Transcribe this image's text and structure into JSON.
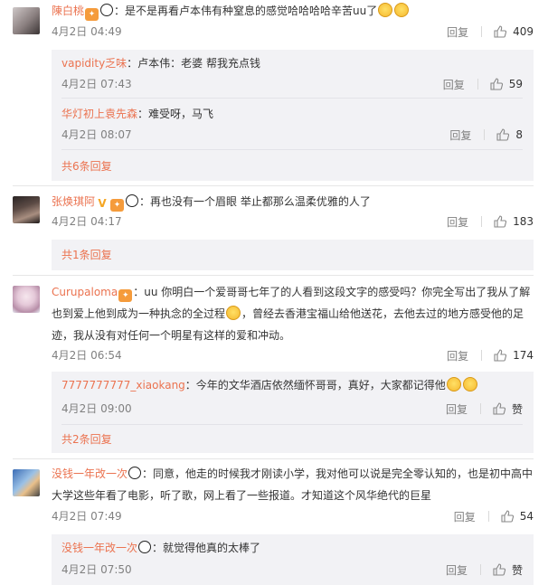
{
  "comments": [
    {
      "user": "陳白桃",
      "text": "：是不是再看卢本伟有种窒息的感觉哈哈哈哈辛苦uu了",
      "date": "4月2日 04:49",
      "reply": "回复",
      "likes": "409",
      "replies": [
        {
          "user": "vapidity乏味",
          "text": "：卢本伟：老婆 帮我充点钱",
          "date": "4月2日 07:43",
          "reply": "回复",
          "likes": "59"
        },
        {
          "user": "华灯初上袁先森",
          "text": "：难受呀，马飞",
          "date": "4月2日 08:07",
          "reply": "回复",
          "likes": "8"
        }
      ],
      "more": "共6条回复"
    },
    {
      "user": "张焕琪阿",
      "text": "：再也没有一个眉眼 举止都那么温柔优雅的人了",
      "date": "4月2日 04:17",
      "reply": "回复",
      "likes": "183",
      "more": "共1条回复"
    },
    {
      "user": "Curupaloma",
      "text": "：uu 你明白一个爱哥哥七年了的人看到这段文字的感受吗？你完全写出了我从了解也到爱上他到成为一种执念的全过程",
      "text2": "，曾经去香港宝福山给他送花，去他去过的地方感受他的足迹，我从没有对任何一个明星有这样的爱和冲动。",
      "date": "4月2日 06:54",
      "reply": "回复",
      "likes": "174",
      "replies": [
        {
          "user": "7777777777_xiaokang",
          "text": "：今年的文华酒店依然缅怀哥哥，真好，大家都记得他",
          "date": "4月2日 09:00",
          "reply": "回复",
          "likes": "赞"
        }
      ],
      "more": "共2条回复"
    },
    {
      "user": "没钱一年改一次",
      "text": "：同意，他走的时候我才刚读小学，我对他可以说是完全零认知的，也是初中高中大学这些年看了电影，听了歌，网上看了一些报道。才知道这个风华绝代的巨星",
      "date": "4月2日 07:49",
      "reply": "回复",
      "likes": "54",
      "replies": [
        {
          "user": "没钱一年改一次",
          "text": "：就觉得他真的太棒了",
          "date": "4月2日 07:50",
          "reply": "回复",
          "likes": "赞"
        }
      ]
    }
  ],
  "colors": {
    "username": "#eb7350",
    "meta": "#808080",
    "subbox": "#f2f2f5"
  },
  "icons": {
    "like": "thumbs-up-icon",
    "panda": "panda-emoji-icon",
    "laugh": "laughing-emoji-icon",
    "cry": "crying-emoji-icon",
    "badge": "member-badge-icon",
    "vip": "vip-v-icon"
  }
}
